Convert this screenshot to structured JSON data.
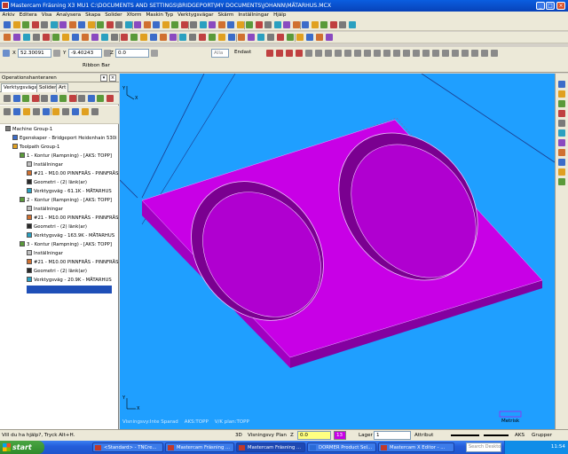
{
  "window": {
    "title": "Mastercam Fräsning X3 MU1  C:\\DOCUMENTS AND SETTINGS\\BRIDGEPORT\\MY DOCUMENTS\\JOHANN\\MÄTARHUS.MCX"
  },
  "menu": [
    "Arkiv",
    "Editera",
    "Visa",
    "Analysera",
    "Skapa",
    "Solider",
    "Xform",
    "Maskin Typ",
    "Verktygsvägar",
    "Skärm",
    "Inställningar",
    "Hjälp"
  ],
  "coords": {
    "x_label": "X",
    "x": "52.30091",
    "y_label": "Y",
    "y": "-9.40243",
    "z_label": "Z",
    "z": "0.0",
    "alla": "Alla",
    "endast": "Endast"
  },
  "ribbon": {
    "label": "Ribbon Bar"
  },
  "ops": {
    "header": "Operationshanteraren",
    "tabs": [
      "Verktygsvägar",
      "Solider",
      "Art"
    ],
    "tree": [
      {
        "text": "Machine Group-1",
        "level": 0,
        "icon": "machine"
      },
      {
        "text": "Egenskaper - Bridgeport Heidenhain 530i",
        "level": 1,
        "icon": "props"
      },
      {
        "text": "Toolpath Group-1",
        "level": 1,
        "icon": "group"
      },
      {
        "text": "1 - Kontur (Rampning) - [AKS: TOPP]",
        "level": 2,
        "icon": "op"
      },
      {
        "text": "Inställningar",
        "level": 3,
        "icon": "params"
      },
      {
        "text": "#21 - M10.00 PINNFRÄS - PINNFRÄS",
        "level": 3,
        "icon": "tool"
      },
      {
        "text": "Geometri - (2) länk(ar)",
        "level": 3,
        "icon": "geo"
      },
      {
        "text": "Verktygsväg - 61.1K - MÄTARHUS",
        "level": 3,
        "icon": "path"
      },
      {
        "text": "2 - Kontur (Rampning) - [AKS: TOPP]",
        "level": 2,
        "icon": "op"
      },
      {
        "text": "Inställningar",
        "level": 3,
        "icon": "params"
      },
      {
        "text": "#21 - M10.00 PINNFRÄS - PINNFRÄS",
        "level": 3,
        "icon": "tool"
      },
      {
        "text": "Geometri - (2) länk(ar)",
        "level": 3,
        "icon": "geo"
      },
      {
        "text": "Verktygsväg - 163.9K - MÄTARHUS",
        "level": 3,
        "icon": "path"
      },
      {
        "text": "3 - Kontur (Rampning) - [AKS: TOPP]",
        "level": 2,
        "icon": "op"
      },
      {
        "text": "Inställningar",
        "level": 3,
        "icon": "params"
      },
      {
        "text": "#21 - M10.00 PINNFRÄS - PINNFRÄS",
        "level": 3,
        "icon": "tool"
      },
      {
        "text": "Geometri - (2) länk(ar)",
        "level": 3,
        "icon": "geo"
      },
      {
        "text": "Verktygsväg - 20.9K - MÄTARHUS",
        "level": 3,
        "icon": "path"
      }
    ]
  },
  "viewport": {
    "bg_color": "#1f9fff",
    "part_color": "#c800e6",
    "status": "Visningsvy:Inte Sparad    AKS:TOPP    V/K plan:TOPP",
    "scale_label": "Metrisk",
    "axis_y": "Y",
    "axis_x": "X"
  },
  "status": {
    "hint": "Vill du ha hjälp?, Tryck Alt+H.",
    "mode3d": "3D",
    "visningsvy": "Visningsvy",
    "plan": "Plan",
    "z_label": "Z",
    "z_value": "0.0",
    "color_num": "13",
    "lager": "Lager",
    "lager_value": "1",
    "attribut": "Attribut",
    "aks": "AKS",
    "grupper": "Grupper"
  },
  "taskbar": {
    "start": "start",
    "items": [
      "<Standard> - TNCre...",
      "Mastercam Fräsning ...",
      "Mastercam Fräsning ...",
      "DORMER Product Sel...",
      "Mastercam X Editor - ..."
    ],
    "search_placeholder": "Search Desktop",
    "clock": "11:54"
  }
}
